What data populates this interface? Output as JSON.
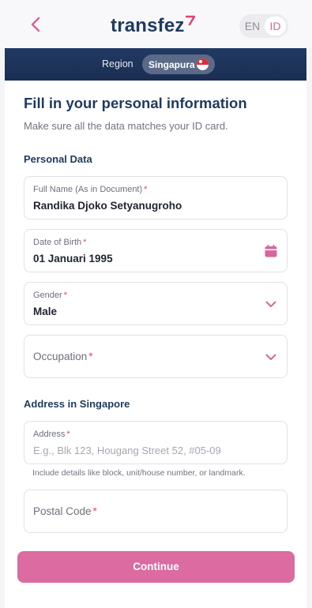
{
  "header": {
    "brand": "transfez",
    "languages": [
      "EN",
      "ID"
    ],
    "active_language": "ID"
  },
  "region": {
    "label": "Region",
    "value": "Singapura",
    "flag": "singapore-flag"
  },
  "form": {
    "title": "Fill in your personal information",
    "subtitle": "Make sure all the data matches your ID card.",
    "personal_section": "Personal Data",
    "full_name": {
      "label": "Full Name (As in Document)",
      "value": "Randika Djoko Setyanugroho"
    },
    "dob": {
      "label": "Date of Birth",
      "value": "01 Januari 1995",
      "icon": "calendar-icon"
    },
    "gender": {
      "label": "Gender",
      "value": "Male",
      "icon": "chevron-down-icon"
    },
    "occupation": {
      "label": "Occupation",
      "icon": "chevron-down-icon"
    },
    "address_section": "Address in Singapore",
    "address": {
      "label": "Address",
      "placeholder": "E.g., Blk 123, Hougang Street 52, #05-09"
    },
    "address_hint": "Include details like block, unit/house number, or landmark.",
    "postal_code": {
      "label": "Postal Code"
    },
    "required_mark": "*",
    "continue_label": "Continue"
  },
  "colors": {
    "brand_navy": "#1e3a5f",
    "accent_pink": "#db6ba1",
    "required_red": "#e2456f"
  }
}
